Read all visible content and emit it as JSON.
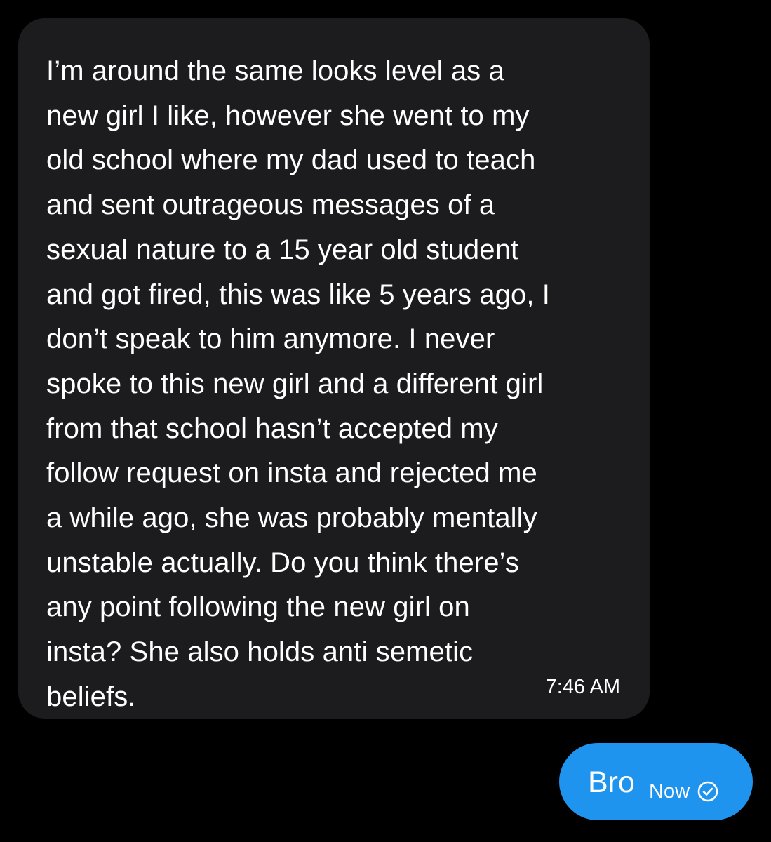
{
  "conversation": {
    "incoming_message": {
      "text": "I’m around the same looks level as a\nnew girl I like, however she went to my\nold school where my dad used to teach\nand sent outrageous messages of a\nsexual nature to a 15 year old student\nand got fired, this was like 5 years ago, I\ndon’t speak to him anymore. I never\nspoke to this new girl and a different girl\nfrom that school hasn’t accepted my\nfollow request on insta and rejected me\na while ago, she was probably mentally\nunstable actually. Do you think there’s\nany point following the new girl on\ninsta? She also holds anti semetic\nbeliefs.",
      "time": "7:46 AM"
    },
    "outgoing_message": {
      "text": "Bro",
      "time": "Now",
      "status_icon": "read-check-icon"
    }
  },
  "colors": {
    "background": "#000000",
    "incoming_bubble": "#1c1c1e",
    "outgoing_bubble": "#1f94ef",
    "text": "#ffffff"
  }
}
